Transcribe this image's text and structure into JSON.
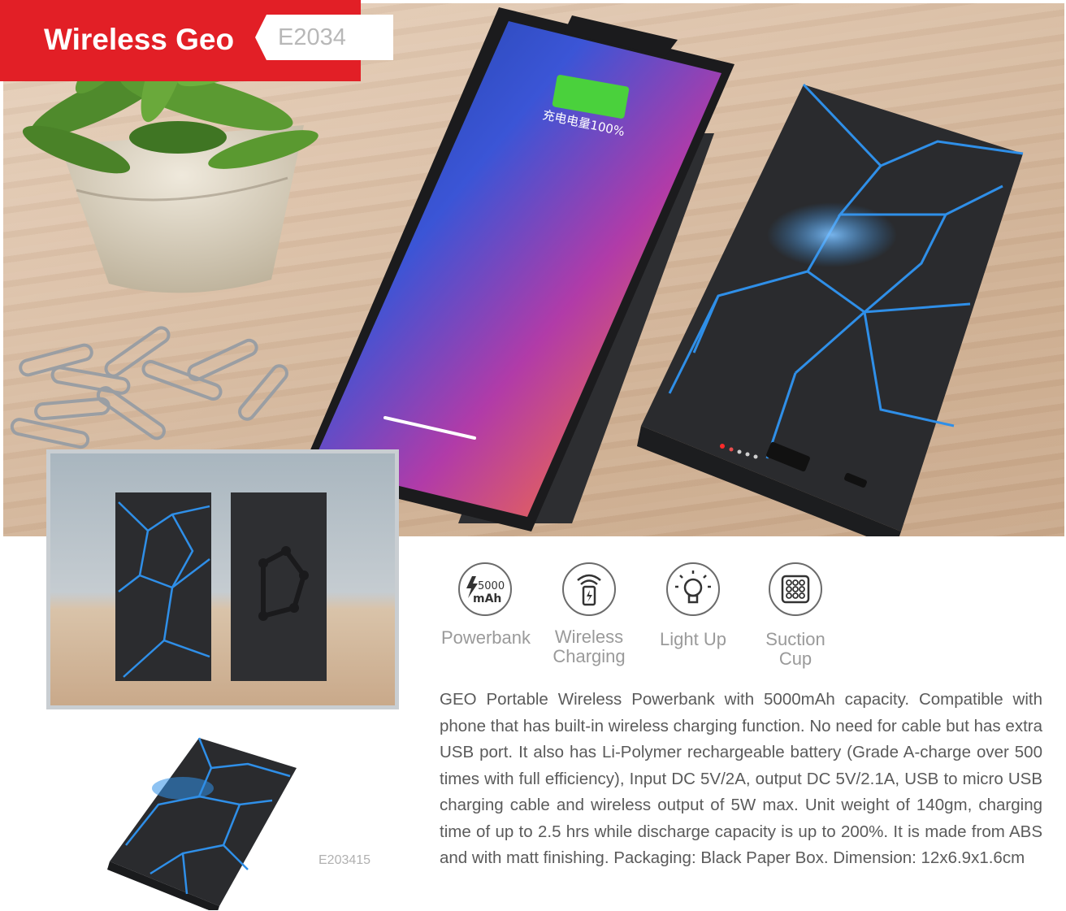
{
  "header": {
    "title": "Wireless Geo",
    "code": "E2034"
  },
  "hero_screen": {
    "charge_text": "充电电量100%"
  },
  "features": [
    {
      "icon": "lightning-battery-icon",
      "badge_top": "5000",
      "badge_bottom": "mAh",
      "label": "Powerbank"
    },
    {
      "icon": "wireless-charging-icon",
      "label_line1": "Wireless",
      "label_line2": "Charging"
    },
    {
      "icon": "light-bulb-icon",
      "label": "Light Up"
    },
    {
      "icon": "suction-cup-icon",
      "label_line1": "Suction",
      "label_line2": "Cup"
    }
  ],
  "description": "GEO Portable Wireless Powerbank with 5000mAh capacity. Compatible with phone that has built-in wireless charging function. No need for cable but has extra USB port. It also has Li-Polymer rechargeable battery (Grade A-charge over 500 times with full efficiency), Input DC 5V/2A, output DC 5V/2.1A, USB to micro USB charging cable and wireless output of 5W max. Unit weight of 140gm, charging time of up to 2.5 hrs while discharge capacity is up to 200%. It is made from ABS and with matt finishing. Packaging: Black Paper Box. Dimension: 12x6.9x1.6cm",
  "variant_code": "E203415",
  "colors": {
    "brand_red": "#e21f26",
    "accent_blue": "#2f8fe8",
    "device_black": "#2a2b2e"
  }
}
